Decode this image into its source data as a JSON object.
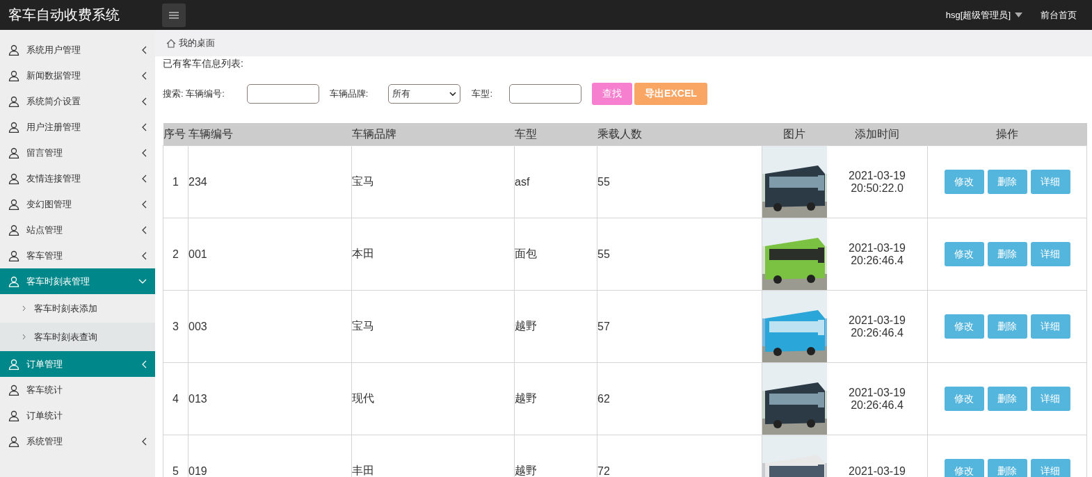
{
  "header": {
    "title": "客车自动收费系统",
    "user": "hsg[超级管理员]",
    "home_link": "前台首页"
  },
  "sidebar": {
    "items": [
      {
        "label": "系统用户管理",
        "expandable": true,
        "expanded": false,
        "selected": false
      },
      {
        "label": "新闻数据管理",
        "expandable": true,
        "expanded": false,
        "selected": false
      },
      {
        "label": "系统简介设置",
        "expandable": true,
        "expanded": false,
        "selected": false
      },
      {
        "label": "用户注册管理",
        "expandable": true,
        "expanded": false,
        "selected": false
      },
      {
        "label": "留言管理",
        "expandable": true,
        "expanded": false,
        "selected": false
      },
      {
        "label": "友情连接管理",
        "expandable": true,
        "expanded": false,
        "selected": false
      },
      {
        "label": "变幻图管理",
        "expandable": true,
        "expanded": false,
        "selected": false
      },
      {
        "label": "站点管理",
        "expandable": true,
        "expanded": false,
        "selected": false
      },
      {
        "label": "客车管理",
        "expandable": true,
        "expanded": false,
        "selected": false
      },
      {
        "label": "客车时刻表管理",
        "expandable": true,
        "expanded": true,
        "selected": true,
        "children": [
          {
            "label": "客车时刻表添加",
            "hovered": false
          },
          {
            "label": "客车时刻表查询",
            "hovered": true
          }
        ]
      },
      {
        "label": "订单管理",
        "expandable": true,
        "expanded": false,
        "selected": true
      },
      {
        "label": "客车统计",
        "selected": false
      },
      {
        "label": "订单统计",
        "selected": false
      },
      {
        "label": "系统管理",
        "expandable": true,
        "expanded": false,
        "selected": false
      }
    ]
  },
  "breadcrumb": "我的桌面",
  "list_title": "已有客车信息列表:",
  "search": {
    "label": "搜索: 车辆编号:",
    "brand_label": "车辆品牌:",
    "brand_value": "所有",
    "type_label": "车型:",
    "search_button": "查找",
    "export_button": "导出EXCEL"
  },
  "table": {
    "columns": [
      "序号",
      "车辆编号",
      "车辆品牌",
      "车型",
      "乘载人数",
      "图片",
      "添加时间",
      "操作"
    ],
    "rows": [
      {
        "no": "1",
        "code": "234",
        "brand": "宝马",
        "type": "asf",
        "seats": "55",
        "date": "2021-03-19",
        "time": "20:50:22.0",
        "actions": [
          "修改",
          "删除",
          "详细"
        ]
      },
      {
        "no": "2",
        "code": "001",
        "brand": "本田",
        "type": "面包",
        "seats": "55",
        "date": "2021-03-19",
        "time": "20:26:46.4",
        "actions": [
          "修改",
          "删除",
          "详细"
        ]
      },
      {
        "no": "3",
        "code": "003",
        "brand": "宝马",
        "type": "越野",
        "seats": "57",
        "date": "2021-03-19",
        "time": "20:26:46.4",
        "actions": [
          "修改",
          "删除",
          "详细"
        ]
      },
      {
        "no": "4",
        "code": "013",
        "brand": "现代",
        "type": "越野",
        "seats": "62",
        "date": "2021-03-19",
        "time": "20:26:46.4",
        "actions": [
          "修改",
          "删除",
          "详细"
        ]
      },
      {
        "no": "5",
        "code": "019",
        "brand": "丰田",
        "type": "越野",
        "seats": "72",
        "date": "2021-03-19",
        "actions": [
          "修改",
          "删除",
          "详细"
        ]
      }
    ]
  }
}
